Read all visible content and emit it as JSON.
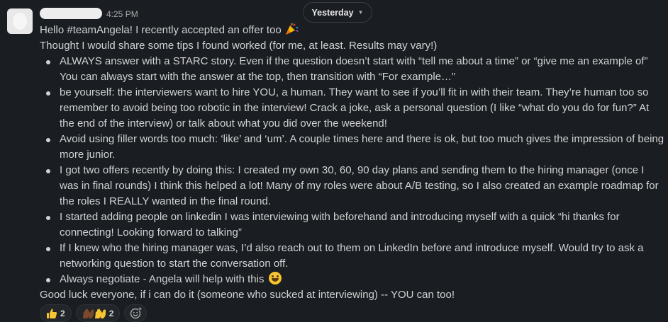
{
  "header": {
    "time": "4:25 PM",
    "date_divider": "Yesterday"
  },
  "message": {
    "greeting": "Hello #teamAngela! I recently accepted an offer too",
    "intro": "Thought I would share some tips I found worked (for me, at least. Results may vary!)",
    "bullets": [
      "ALWAYS answer with a STARC story. Even if the question doesn’t start with “tell me about a time” or “give me an example of” You can always start with the answer at the top, then transition with “For example…”",
      "be yourself: the interviewers want to hire YOU, a human. They want to see if you’ll fit in with their team. They’re human too so remember to avoid being too robotic in the interview! Crack a joke, ask a personal question (I like “what do you do for fun?” At the end of the interview) or talk about what you did over the weekend!",
      "Avoid using filler words too much: ‘like’ and ‘um’. A couple times here and there is ok, but too much gives the impression of being more junior.",
      "I got two offers recently by doing this: I created my own 30, 60, 90 day plans and sending them to the hiring manager (once I was in final rounds) I think this helped a lot! Many of my roles were about A/B testing, so I also created an example roadmap for the roles I REALLY wanted in the final round.",
      "I started adding people on linkedin I was interviewing with beforehand and introducing myself with a quick “hi thanks for connecting! Looking forward to talking”",
      "If I knew who the hiring manager was, I’d also reach out to them on LinkedIn before and introduce myself. Would try to ask a networking question to start the conversation off.",
      "Always negotiate - Angela will help with this"
    ],
    "closing": "Good luck everyone, if i can do it (someone who sucked at interviewing)  -- YOU can too!"
  },
  "reactions": [
    {
      "icon": "thumbs-up-icon",
      "count": "2"
    },
    {
      "icon": "raised-hands-icon",
      "count": "2"
    }
  ],
  "icons": {
    "greeting_emoji": "party-popper-icon",
    "negotiate_emoji": "grinning-face-icon",
    "add_reaction": "add-reaction-icon"
  },
  "colors": {
    "background": "#1a1d21",
    "text": "#d1d2d3",
    "muted": "#ababad"
  }
}
